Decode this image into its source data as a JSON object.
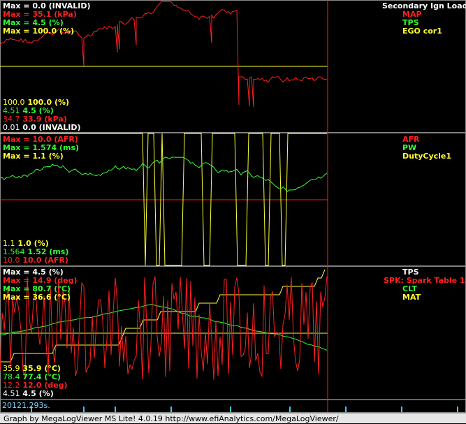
{
  "panels": [
    {
      "id": "p1",
      "title": "Secondary Ign Load",
      "max_labels": [
        {
          "text": "Max = 0.0 (INVALID)",
          "color": "#ffffff"
        },
        {
          "text": "Max = 35.1 (kPa)",
          "color": "#ff2020"
        },
        {
          "text": "Max = 4.5 (%)",
          "color": "#33ff33"
        },
        {
          "text": "Max = 100.0 (%)",
          "color": "#ffff33"
        }
      ],
      "legend": [
        {
          "text": "MAP",
          "color": "#ff2020"
        },
        {
          "text": "TPS",
          "color": "#33ff33"
        },
        {
          "text": "EGO cor1",
          "color": "#ffff33"
        }
      ],
      "min_labels": [
        {
          "min": "100.0",
          "cur": "100.0 (%)",
          "color": "#ffff33"
        },
        {
          "min": "4.51",
          "cur": "4.5 (%)",
          "color": "#33ff33"
        },
        {
          "min": "34.7",
          "cur": "33.9 (kPa)",
          "color": "#ff2020"
        },
        {
          "min": "0.01",
          "cur": "0.0 (INVALID)",
          "color": "#ffffff"
        }
      ]
    },
    {
      "id": "p2",
      "title": "",
      "max_labels": [
        {
          "text": "Max = 10.0 (AFR)",
          "color": "#ff2020"
        },
        {
          "text": "Max = 1.574 (ms)",
          "color": "#33ff33"
        },
        {
          "text": "Max = 1.1 (%)",
          "color": "#ffff33"
        }
      ],
      "legend": [
        {
          "text": "AFR",
          "color": "#ff2020"
        },
        {
          "text": "PW",
          "color": "#33ff33"
        },
        {
          "text": "DutyCycle1",
          "color": "#ffff33"
        }
      ],
      "min_labels": [
        {
          "min": "1.1",
          "cur": "1.0 (%)",
          "color": "#ffff33"
        },
        {
          "min": "1.564",
          "cur": "1.52 (ms)",
          "color": "#33ff33"
        },
        {
          "min": "10.0",
          "cur": "10.0 (AFR)",
          "color": "#ff2020"
        }
      ]
    },
    {
      "id": "p3",
      "title": "",
      "max_labels": [
        {
          "text": "Max = 4.5 (%)",
          "color": "#ffffff"
        },
        {
          "text": "Max = 14.9 (deg)",
          "color": "#ff2020"
        },
        {
          "text": "Max = 80.7 (°C)",
          "color": "#33ff33"
        },
        {
          "text": "Max = 36.6 (°C)",
          "color": "#ffff33"
        }
      ],
      "legend": [
        {
          "text": "TPS",
          "color": "#ffffff"
        },
        {
          "text": "SPK: Spark Table 1",
          "color": "#ff2020"
        },
        {
          "text": "CLT",
          "color": "#33ff33"
        },
        {
          "text": "MAT",
          "color": "#ffff33"
        }
      ],
      "min_labels": [
        {
          "min": "35.9",
          "cur": "35.9 (°C)",
          "color": "#ffff33"
        },
        {
          "min": "78.4",
          "cur": "77.4 (°C)",
          "color": "#33ff33"
        },
        {
          "min": "12.2",
          "cur": "12.0 (deg)",
          "color": "#ff2020"
        },
        {
          "min": "4.51",
          "cur": "4.5 (%)",
          "color": "#ffffff"
        }
      ]
    }
  ],
  "time_label": "20121.293s.",
  "footer": "Graph by MegaLogViewer MS Lite! 4.0.19 http://www.efiAnalytics.com/MegaLogViewer/"
}
